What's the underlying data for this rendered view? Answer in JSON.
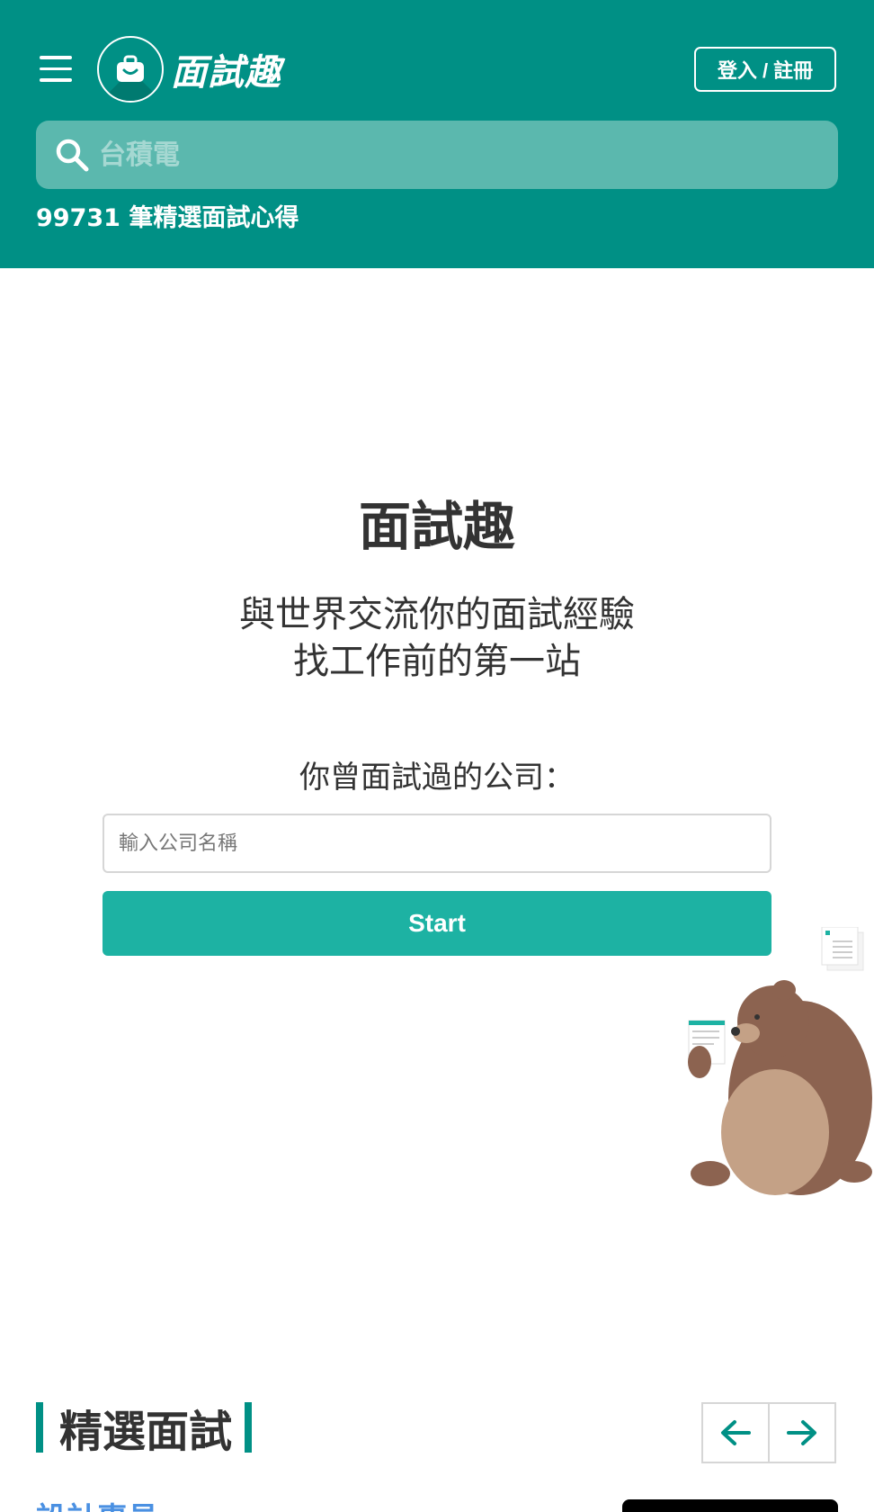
{
  "header": {
    "logo_text": "面試趣",
    "login_label": "登入 / 註冊",
    "search": {
      "placeholder": "台積電"
    },
    "stat_text": "99731 筆精選面試心得",
    "colors": {
      "background": "#009085",
      "search_bg": "#5bb8ae"
    },
    "icons": [
      "menu-icon",
      "briefcase-icon",
      "search-icon"
    ]
  },
  "hero": {
    "title": "面試趣",
    "tagline_line1": "與世界交流你的面試經驗",
    "tagline_line2": "找工作前的第一站",
    "form_label": "你曾面試過的公司：",
    "company_input": {
      "placeholder": "輸入公司名稱",
      "value": ""
    },
    "start_label": "Start",
    "colors": {
      "start_button": "#1db2a3"
    }
  },
  "featured": {
    "title": "精選面試",
    "icons": [
      "arrow-left-icon",
      "arrow-right-icon"
    ],
    "peek_item_text": "設計專員"
  }
}
